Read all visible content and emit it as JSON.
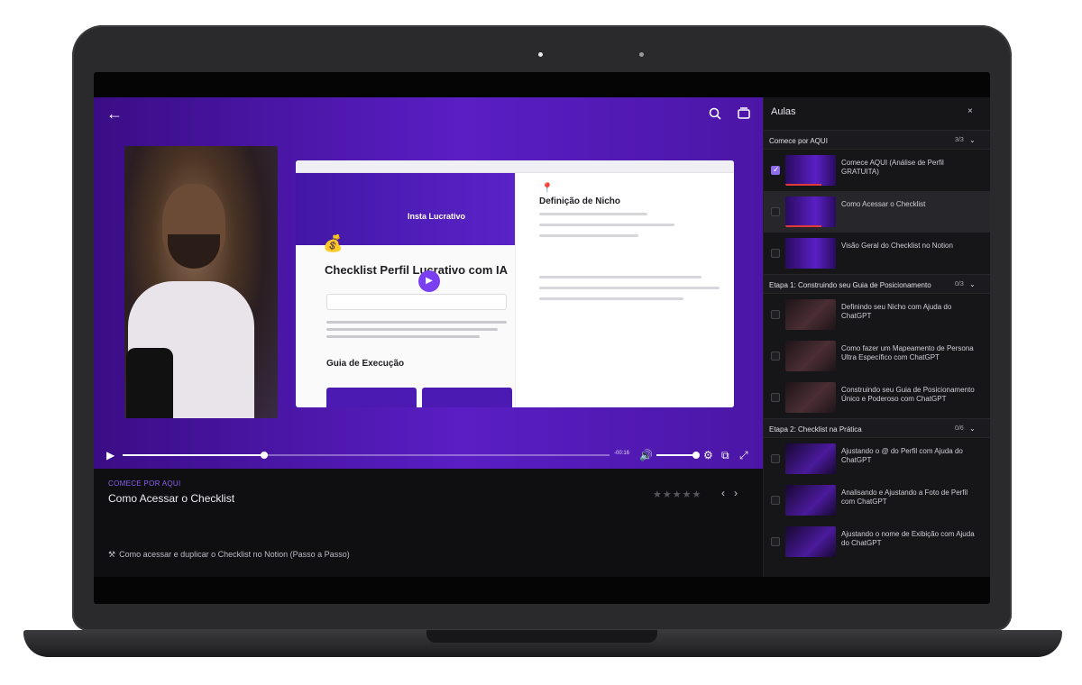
{
  "player": {
    "icons": {
      "back": "arrow-left-icon",
      "search": "search-icon",
      "cast": "cast-icon"
    },
    "time": "-00:16"
  },
  "notion": {
    "logo": "Insta Lucrativo",
    "emoji": "💰",
    "title": "Checklist Perfil Lucrativo com IA",
    "section_heading": "Guia de Execução",
    "right_title": "Definição de Nicho"
  },
  "lesson": {
    "section_label": "COMECE POR AQUI",
    "title": "Como Acessar o Checklist",
    "rating_stars": "★★★★★",
    "prev": "‹",
    "next": "›",
    "description": "Como acessar e duplicar o Checklist no Notion (Passo a Passo)"
  },
  "sidebar": {
    "title": "Aulas",
    "close": "×",
    "sections": [
      {
        "name": "Comece por AQUI",
        "count": "3/3",
        "items": [
          {
            "label": "Comece AQUI (Análise de Perfil GRATUITA)",
            "checked": true,
            "active": false,
            "thumb": "purple",
            "progress": true
          },
          {
            "label": "Como Acessar o Checklist",
            "checked": false,
            "active": true,
            "thumb": "purple",
            "progress": true
          },
          {
            "label": "Visão Geral do Checklist no Notion",
            "checked": false,
            "active": false,
            "thumb": "purple",
            "progress": false
          }
        ]
      },
      {
        "name": "Etapa 1: Construindo seu Guia de Posicionamento",
        "count": "0/3",
        "items": [
          {
            "label": "Definindo seu Nicho com Ajuda do ChatGPT",
            "checked": false,
            "active": false,
            "thumb": "brown",
            "progress": false
          },
          {
            "label": "Como fazer um Mapeamento de Persona Ultra Específico com ChatGPT",
            "checked": false,
            "active": false,
            "thumb": "brown",
            "progress": false
          },
          {
            "label": "Construindo seu Guia de Posicionamento Único e Poderoso com ChatGPT",
            "checked": false,
            "active": false,
            "thumb": "brown",
            "progress": false
          }
        ]
      },
      {
        "name": "Etapa 2: Checklist na Prática",
        "count": "0/6",
        "items": [
          {
            "label": "Ajustando o @ do Perfil com Ajuda do ChatGPT",
            "checked": false,
            "active": false,
            "thumb": "violet",
            "progress": false
          },
          {
            "label": "Analisando e Ajustando a Foto de Perfil com ChatGPT",
            "checked": false,
            "active": false,
            "thumb": "violet",
            "progress": false
          },
          {
            "label": "Ajustando o nome de Exibição com Ajuda do ChatGPT",
            "checked": false,
            "active": false,
            "thumb": "violet",
            "progress": false
          }
        ]
      }
    ]
  },
  "progress": {
    "played_fraction": 0.29
  },
  "colors": {
    "accent": "#8e6cf0",
    "player_bg": "#4b16a6",
    "progress_red": "#e03a3a"
  }
}
